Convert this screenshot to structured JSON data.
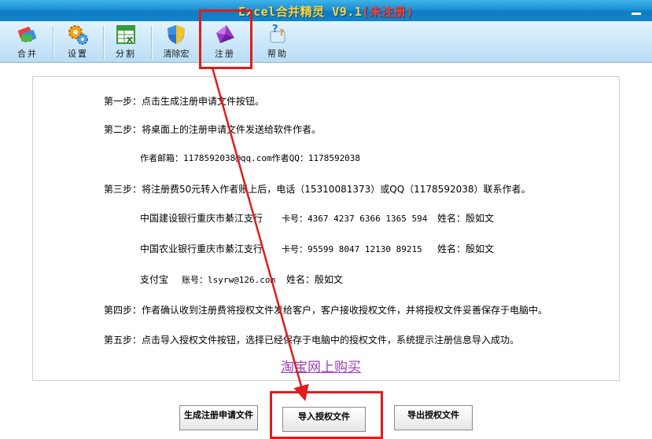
{
  "window": {
    "title": "Excel合并精灵 V9.1",
    "title_suffix": "(未注册)"
  },
  "toolbar": {
    "items": [
      {
        "label": "合并",
        "icon": "merge-icon"
      },
      {
        "label": "设置",
        "icon": "settings-gears-icon"
      },
      {
        "label": "分割",
        "icon": "split-sheet-icon"
      },
      {
        "label": "清除宏",
        "icon": "shield-icon"
      },
      {
        "label": "注册",
        "icon": "register-gem-icon"
      },
      {
        "label": "帮助",
        "icon": "help-icon"
      }
    ]
  },
  "steps": {
    "step1": "第一步：点击生成注册申请文件按钮。",
    "step2": "第二步：将桌面上的注册申请文件发送给软件作者。",
    "contact_email": "作者邮箱：1178592038@qq.com作者QQ：1178592038",
    "step3": "第三步：将注册费50元转入作者账上后，电话（15310081373）或QQ（1178592038）联系作者。",
    "bank1_name": "中国建设银行重庆市綦江支行",
    "bank1_card": "卡号：4367 4237 6366 1365 594",
    "bank1_owner": "姓名：殷如文",
    "bank2_name": "中国农业银行重庆市綦江支行",
    "bank2_card": "卡号：95599 8047 12130 89215",
    "bank2_owner": "姓名：殷如文",
    "alipay_name": "支付宝",
    "alipay_account": "账号：lsyrw@126.com",
    "alipay_owner": "姓名：殷如文",
    "step4": "第四步：作者确认收到注册费将授权文件发给客户，客户接收授权文件，并将授权文件妥善保存于电脑中。",
    "step5": "第五步：点击导入授权文件按钮，选择已经保存于电脑中的授权文件，系统提示注册信息导入成功。"
  },
  "link": {
    "taobao": "淘宝网上购买"
  },
  "buttons": {
    "generate": "生成注册申请文件",
    "import": "导入授权文件",
    "export": "导出授权文件"
  },
  "colors": {
    "titlebar": "#1a8fd4",
    "title_text": "#ffd63a",
    "title_suffix": "#ff3b30",
    "highlight": "#e21b1b",
    "link": "#9b3fb8"
  }
}
